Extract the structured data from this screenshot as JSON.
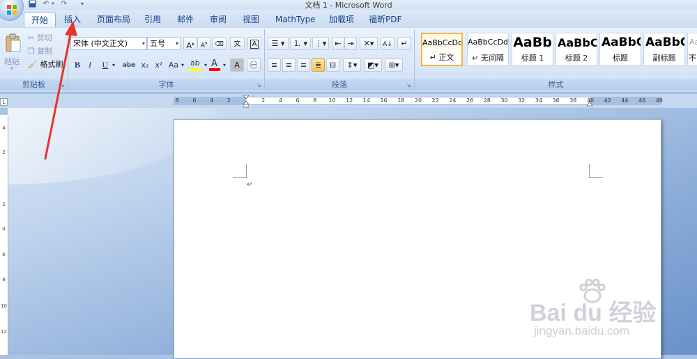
{
  "window": {
    "title": "文档 1 - Microsoft Word"
  },
  "quick_access": {
    "save_icon": "save-icon",
    "undo_icon": "undo-icon",
    "redo_icon": "redo-icon",
    "customize_icon": "dropdown-icon"
  },
  "tabs": [
    {
      "label": "开始",
      "active": true
    },
    {
      "label": "插入",
      "active": false
    },
    {
      "label": "页面布局",
      "active": false
    },
    {
      "label": "引用",
      "active": false
    },
    {
      "label": "邮件",
      "active": false
    },
    {
      "label": "审阅",
      "active": false
    },
    {
      "label": "视图",
      "active": false
    },
    {
      "label": "MathType",
      "active": false
    },
    {
      "label": "加载项",
      "active": false
    },
    {
      "label": "福昕PDF",
      "active": false
    }
  ],
  "clipboard": {
    "group_label": "剪贴板",
    "paste_label": "粘贴",
    "cut_label": "剪切",
    "copy_label": "复制",
    "format_painter_label": "格式刷"
  },
  "font": {
    "group_label": "字体",
    "font_name": "宋体 (中文正文)",
    "font_size": "五号",
    "bold": "B",
    "italic": "I",
    "underline": "U",
    "strike": "abe",
    "subscript": "x₂",
    "superscript": "x²",
    "change_case": "Aa",
    "font_color": "A",
    "highlight_color": "#ffff00",
    "font_color_bar": "#ff0000"
  },
  "paragraph": {
    "group_label": "段落"
  },
  "styles": {
    "group_label": "样式",
    "items": [
      {
        "sample": "AaBbCcDd",
        "name": "↵ 正文",
        "selected": true
      },
      {
        "sample": "AaBbCcDd",
        "name": "↵ 无间隔",
        "selected": false
      },
      {
        "sample": "AaBb",
        "name": "标题 1",
        "selected": false
      },
      {
        "sample": "AaBbC",
        "name": "标题 2",
        "selected": false
      },
      {
        "sample": "AaBbC",
        "name": "标题",
        "selected": false
      },
      {
        "sample": "AaBbC",
        "name": "副标题",
        "selected": false
      },
      {
        "sample": "Aa",
        "name": "不",
        "selected": false
      }
    ]
  },
  "ruler": {
    "left_numbers": [
      "8",
      "6",
      "4",
      "2"
    ],
    "numbers": [
      "2",
      "4",
      "6",
      "8",
      "10",
      "12",
      "14",
      "16",
      "18",
      "20",
      "22",
      "24",
      "26",
      "28",
      "30",
      "32",
      "34",
      "36",
      "38",
      "40",
      "42",
      "44",
      "46",
      "48"
    ],
    "vertical_numbers": [
      "4",
      "2",
      "2",
      "4",
      "6",
      "8",
      "10",
      "12"
    ]
  },
  "document": {
    "paragraph_mark": "↵"
  },
  "watermark": {
    "brand": "Bai du 经验",
    "url": "jingyan.baidu.com"
  },
  "annotation": {
    "color": "#e8332a"
  }
}
